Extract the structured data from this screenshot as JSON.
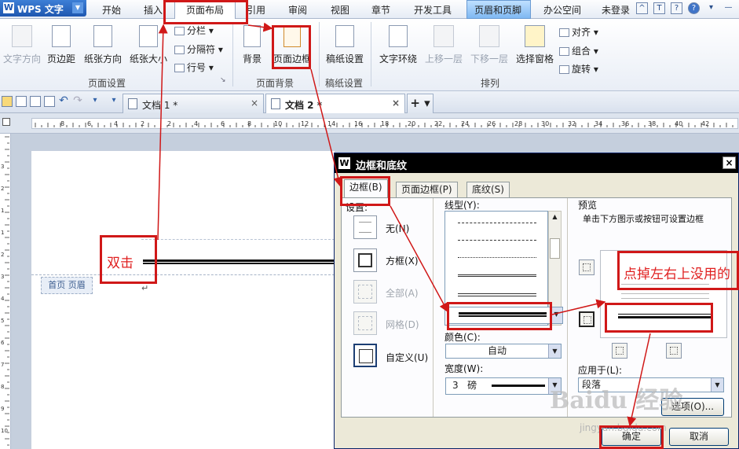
{
  "app": {
    "logo_text": "W",
    "name": "WPS 文字",
    "dropdown": "▼"
  },
  "menu": {
    "items": [
      "开始",
      "插入",
      "页面布局",
      "引用",
      "审阅",
      "视图",
      "章节",
      "开发工具",
      "页眉和页脚",
      "办公空间"
    ],
    "login": "未登录"
  },
  "ribbon": {
    "groups": {
      "page_setup": {
        "label": "页面设置",
        "buttons": [
          "文字方向",
          "页边距",
          "纸张方向",
          "纸张大小"
        ],
        "small": [
          "分栏",
          "分隔符",
          "行号"
        ]
      },
      "page_background": {
        "label": "页面背景",
        "buttons": [
          "背景",
          "页面边框"
        ]
      },
      "draft": {
        "label": "稿纸设置",
        "buttons": [
          "稿纸设置"
        ]
      },
      "arrange": {
        "label": "排列",
        "buttons": [
          "文字环绕",
          "上移一层",
          "下移一层",
          "选择窗格"
        ],
        "small": [
          "对齐",
          "组合",
          "旋转"
        ]
      }
    }
  },
  "tabs": [
    {
      "name": "文档 1 *",
      "close": "×"
    },
    {
      "name": "文档 2 *",
      "close": "×"
    }
  ],
  "new_tab": "+",
  "ruler_numbers": [
    "8",
    "6",
    "4",
    "2",
    "2",
    "4",
    "6",
    "8",
    "10",
    "12",
    "14",
    "16",
    "18",
    "20",
    "22",
    "24",
    "26",
    "28",
    "30",
    "32",
    "34",
    "36",
    "38",
    "40",
    "42"
  ],
  "vruler_numbers": [
    "3",
    "2",
    "1",
    "1",
    "2",
    "3",
    "4",
    "5",
    "6",
    "7",
    "8",
    "9",
    "10",
    "11"
  ],
  "document": {
    "header_label": "首页 页眉",
    "para_mark": "↵"
  },
  "dialog": {
    "title_icon": "W",
    "title": "边框和底纹",
    "close": "×",
    "tabs": [
      "边框(B)",
      "页面边框(P)",
      "底纹(S)"
    ],
    "settings_label": "设置:",
    "settings": [
      {
        "label": "无(N)",
        "enabled": true
      },
      {
        "label": "方框(X)",
        "enabled": true
      },
      {
        "label": "全部(A)",
        "enabled": false
      },
      {
        "label": "网格(D)",
        "enabled": false
      },
      {
        "label": "自定义(U)",
        "enabled": true
      }
    ],
    "line_style_label": "线型(Y):",
    "color_label": "颜色(C):",
    "color_value": "自动",
    "width_label": "宽度(W):",
    "width_value": "3   磅",
    "preview_label": "预览",
    "preview_hint": "单击下方图示或按钮可设置边框",
    "apply_label": "应用于(L):",
    "apply_value": "段落",
    "options_button": "选项(O)...",
    "ok_button": "确定",
    "cancel_button": "取消"
  },
  "annotations": {
    "double_click": "双击",
    "remove_lines": "点掉左右上没用的"
  },
  "watermark": {
    "brand": "Baidu 经验",
    "url": "jingyan.baidu.com"
  },
  "colors": {
    "annotation_red": "#d01818",
    "hf_tab": "#7fb8f2",
    "dialog_title": "#000000"
  }
}
